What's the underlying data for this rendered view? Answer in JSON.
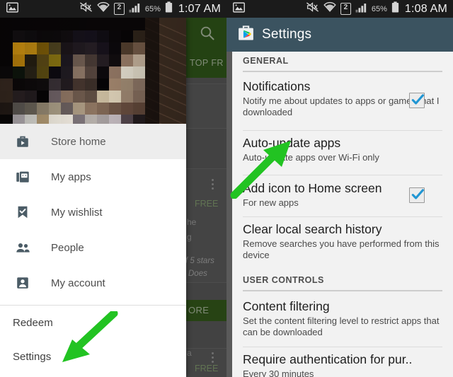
{
  "statusbar": {
    "left": {
      "gallery_icon": "image-icon",
      "mute_icon": "mute-icon",
      "wifi_icon": "wifi-icon",
      "sim_badge": "2",
      "signal_icon": "signal-bars-icon",
      "battery_percent": "65%",
      "battery_icon": "battery-icon",
      "time": "1:07 AM"
    },
    "right": {
      "gallery_icon": "image-icon",
      "mute_icon": "mute-icon",
      "wifi_icon": "wifi-icon",
      "sim_badge": "2",
      "signal_icon": "signal-bars-icon",
      "battery_percent": "65%",
      "battery_icon": "battery-icon",
      "time": "1:08 AM"
    }
  },
  "left_screen": {
    "store": {
      "search_icon": "search-icon",
      "tab_label": "TOP FR",
      "more_button_label": "ORE",
      "fragments": {
        "free_1": "FREE",
        "line_1": "he",
        "line_2": "g",
        "stars": "f 5 stars",
        "does": "Does",
        "app_name": "a",
        "free_2": "FREE"
      }
    },
    "drawer": {
      "header_image": "blurred-photo",
      "items": [
        {
          "label": "Store home",
          "icon": "store-bag-icon",
          "selected": true
        },
        {
          "label": "My apps",
          "icon": "my-apps-icon",
          "selected": false
        },
        {
          "label": "My wishlist",
          "icon": "bookmark-check-icon",
          "selected": false
        },
        {
          "label": "People",
          "icon": "people-icon",
          "selected": false
        },
        {
          "label": "My account",
          "icon": "account-icon",
          "selected": false
        }
      ],
      "secondary_items": [
        {
          "label": "Redeem"
        },
        {
          "label": "Settings"
        }
      ]
    },
    "annotation": {
      "arrow": "green-arrow-pointing-to-settings",
      "color": "#22c322"
    }
  },
  "right_screen": {
    "header": {
      "title": "Settings",
      "icon": "play-store-bag-icon",
      "bg": "#3b5360"
    },
    "sections": [
      {
        "label": "GENERAL",
        "rows": [
          {
            "title": "Notifications",
            "subtitle": "Notify me about updates to apps or games that I downloaded",
            "checkbox": true,
            "checked": true
          },
          {
            "title": "Auto-update apps",
            "subtitle": "Auto-update apps over Wi-Fi only",
            "checkbox": false,
            "checked": false
          },
          {
            "title": "Add icon to Home screen",
            "subtitle": "For new apps",
            "checkbox": true,
            "checked": true
          },
          {
            "title": "Clear local search history",
            "subtitle": "Remove searches you have performed from this device",
            "checkbox": false,
            "checked": false
          }
        ]
      },
      {
        "label": "USER CONTROLS",
        "rows": [
          {
            "title": "Content filtering",
            "subtitle": "Set the content filtering level to restrict apps that can be downloaded",
            "checkbox": false,
            "checked": false
          },
          {
            "title": "Require authentication for pur..",
            "subtitle": "Every 30 minutes",
            "checkbox": false,
            "checked": false
          }
        ]
      }
    ],
    "annotation": {
      "arrow": "green-arrow-pointing-to-auto-update-apps",
      "color": "#22c322"
    }
  },
  "colors": {
    "accent_green": "#22c322",
    "header_slate": "#3b5360",
    "store_green": "#3a6b1f",
    "checkbox_blue": "#2196d3",
    "statusbar_bg": "#1b1b1b"
  }
}
